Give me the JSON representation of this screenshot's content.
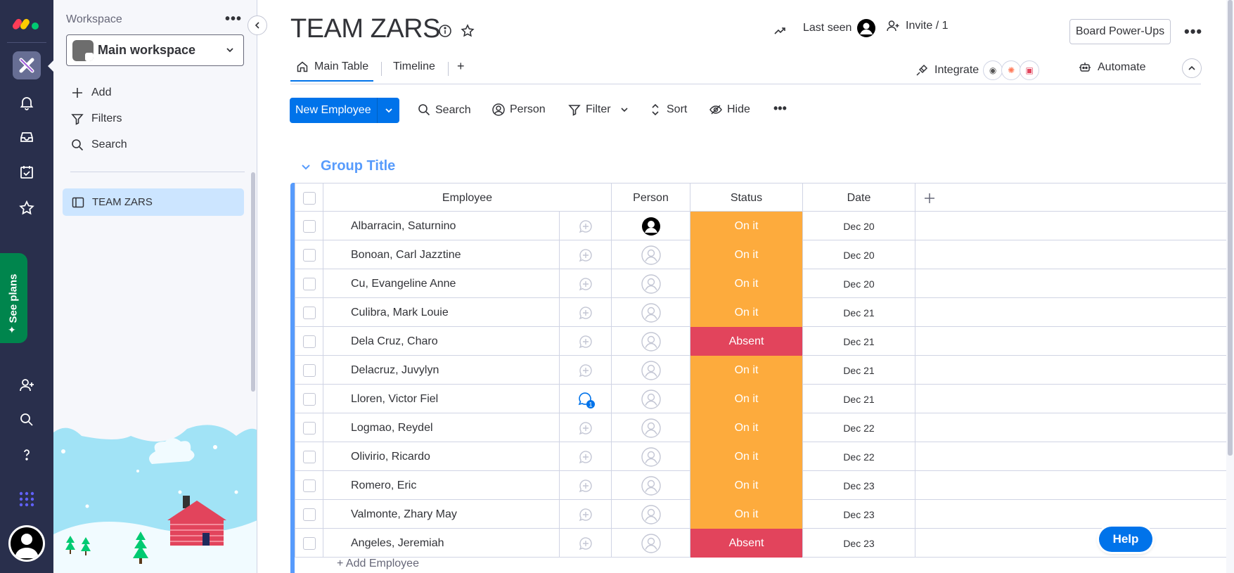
{
  "sidebar": {
    "workspace_label": "Workspace",
    "workspace_name": "Main workspace",
    "actions": [
      "Add",
      "Filters",
      "Search"
    ],
    "boards": [
      "TEAM ZARS"
    ],
    "see_plans": "See plans"
  },
  "header": {
    "title": "TEAM ZARS",
    "last_seen": "Last seen",
    "invite": "Invite / 1",
    "power_ups": "Board Power-Ups",
    "tabs": [
      "Main Table",
      "Timeline",
      "+"
    ],
    "integrate": "Integrate",
    "automate": "Automate"
  },
  "toolbar": {
    "new_item": "New Employee",
    "search": "Search",
    "person": "Person",
    "filter": "Filter",
    "sort": "Sort",
    "hide": "Hide"
  },
  "group": {
    "title": "Group Title",
    "columns": [
      "Employee",
      "Person",
      "Status",
      "Date"
    ],
    "rows": [
      {
        "name": "Albarracin, Saturnino",
        "status": "On it",
        "date": "Dec 20",
        "person_assigned": true,
        "updates": 0
      },
      {
        "name": "Bonoan, Carl Jazztine",
        "status": "On it",
        "date": "Dec 20",
        "person_assigned": false,
        "updates": 0
      },
      {
        "name": "Cu, Evangeline Anne",
        "status": "On it",
        "date": "Dec 20",
        "person_assigned": false,
        "updates": 0
      },
      {
        "name": "Culibra, Mark Louie",
        "status": "On it",
        "date": "Dec 21",
        "person_assigned": false,
        "updates": 0
      },
      {
        "name": "Dela Cruz, Charo",
        "status": "Absent",
        "date": "Dec 21",
        "person_assigned": false,
        "updates": 0
      },
      {
        "name": "Delacruz, Juvylyn",
        "status": "On it",
        "date": "Dec 21",
        "person_assigned": false,
        "updates": 0
      },
      {
        "name": "Lloren, Victor Fiel",
        "status": "On it",
        "date": "Dec 21",
        "person_assigned": false,
        "updates": 1
      },
      {
        "name": "Logmao, Reydel",
        "status": "On it",
        "date": "Dec 22",
        "person_assigned": false,
        "updates": 0
      },
      {
        "name": "Olivirio, Ricardo",
        "status": "On it",
        "date": "Dec 22",
        "person_assigned": false,
        "updates": 0
      },
      {
        "name": "Romero, Eric",
        "status": "On it",
        "date": "Dec 23",
        "person_assigned": false,
        "updates": 0
      },
      {
        "name": "Valmonte, Zhary May",
        "status": "On it",
        "date": "Dec 23",
        "person_assigned": false,
        "updates": 0
      },
      {
        "name": "Angeles, Jeremiah",
        "status": "Absent",
        "date": "Dec 23",
        "person_assigned": false,
        "updates": 0
      }
    ],
    "add_item": "+ Add Employee"
  },
  "help": "Help",
  "colors": {
    "rail": "#292f4c",
    "primary": "#0073ea",
    "group": "#579bfc",
    "on_it": "#fdab3d",
    "absent": "#e2445c",
    "see_plans": "#00854d"
  }
}
